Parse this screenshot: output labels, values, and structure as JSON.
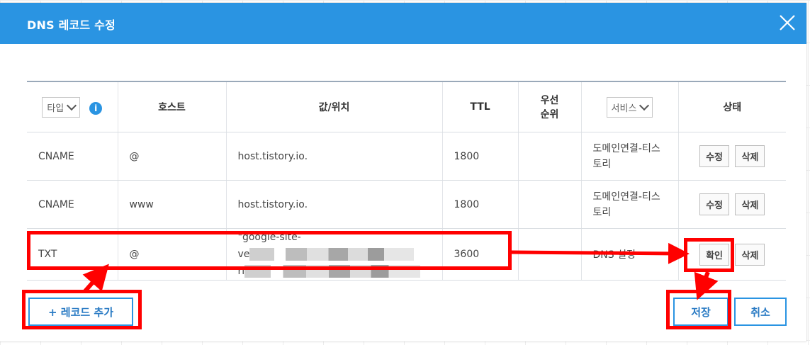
{
  "dialog": {
    "title": "DNS 레코드 수정",
    "close_icon": "close-icon"
  },
  "table": {
    "headers": {
      "type_select": "타입",
      "host": "호스트",
      "value": "값/위치",
      "ttl": "TTL",
      "priority_line1": "우선",
      "priority_line2": "순위",
      "service_select": "서비스",
      "status": "상태"
    },
    "rows": [
      {
        "type": "CNAME",
        "host": "@",
        "value": "host.tistory.io.",
        "ttl": "1800",
        "priority": "",
        "service": "도메인연결-티스토리",
        "actions": [
          "수정",
          "삭제"
        ]
      },
      {
        "type": "CNAME",
        "host": "www",
        "value": "host.tistory.io.",
        "ttl": "1800",
        "priority": "",
        "service": "도메인연결-티스토리",
        "actions": [
          "수정",
          "삭제"
        ]
      },
      {
        "type": "TXT",
        "host": "@",
        "value_line1": "\"google-site-",
        "value_line2": "ve",
        "value_line3": "rl",
        "ttl": "3600",
        "priority": "",
        "service": "DNS 설정",
        "actions": [
          "확인",
          "삭제"
        ]
      }
    ]
  },
  "footer": {
    "add_record": "+ 레코드 추가",
    "save": "저장",
    "cancel": "취소"
  },
  "colors": {
    "header_bg": "#2a94e2",
    "annotation": "#ff0000"
  }
}
